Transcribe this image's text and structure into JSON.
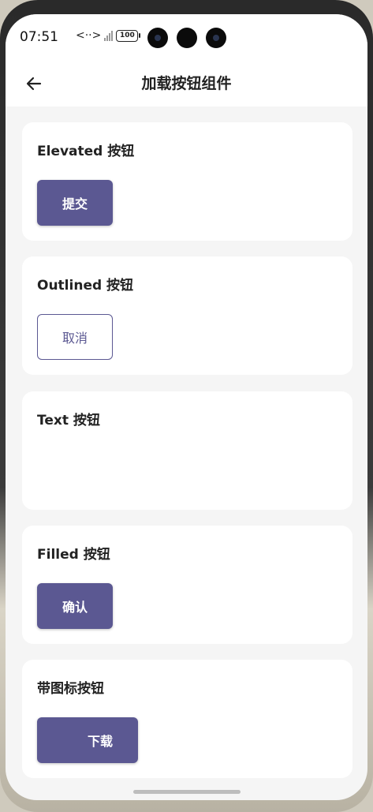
{
  "status_bar": {
    "time": "07:51",
    "data_arrows": "<··>",
    "signal_label": "x",
    "battery": "100"
  },
  "app_bar": {
    "back_icon": "arrow-back-icon",
    "title": "加载按钮组件"
  },
  "cards": [
    {
      "title": "Elevated 按钮",
      "button_label": "提交"
    },
    {
      "title": "Outlined 按钮",
      "button_label": "取消"
    },
    {
      "title": "Text 按钮",
      "button_label": ""
    },
    {
      "title": "Filled 按钮",
      "button_label": "确认"
    },
    {
      "title": "带图标按钮",
      "button_label": "下载"
    }
  ],
  "colors": {
    "accent": "#5b5892",
    "background": "#f5f5f5",
    "card": "#ffffff"
  }
}
